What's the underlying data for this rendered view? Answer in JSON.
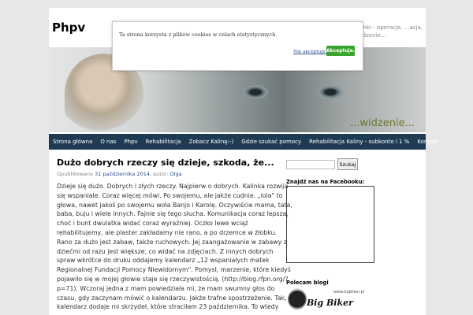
{
  "site": {
    "title": "Phpv",
    "tagline": "...inki - operacje, ...acja, widzenie..."
  },
  "banner": {
    "caption": "...widzenie..."
  },
  "nav": {
    "items": [
      "Strona główna",
      "O nas",
      "Phpv",
      "Rehabilitacja",
      "Zobacz Kalinę:-)",
      "Gdzie szukać pomocy",
      "Rehabilitacja Kaliny - subkonto i 1 %",
      "Kontakt"
    ]
  },
  "post": {
    "title": "Dużo dobrych rzeczy się dzieje, szkoda, że...",
    "meta_prefix": "Opublikowano",
    "date": "31 października 2014",
    "meta_author_prefix": ", autor:",
    "author": "Olga",
    "body": "Dzieje się dużo. Dobrych i złych rzeczy. Najpierw o dobrych. Kalinka rozwija się wspaniale. Coraz więcej mówi. Po swojemu, ale jakże cudnie. „lola\" to głowa, nawet jakoś po swojemu woła Banjo i Karolę. Oczywiście mama, tata, baba, buju i wiele innych. Fajnie się tego słucha. Komunikacja coraz lepsza, choć i bunt dwulatka widać coraz wyraźniej. Oczko lewe wciąż rehabilitujemy, ale plaster zakładamy nie rano, a po drzemce w żłobku. Rano za dużo jest zabaw, także ruchowych. Jej zaangażowanie w zabawy z dziećmi od razu jest większe, co widać na zdjęciach. Z innych dobrych spraw wkrótce do druku oddajemy kalendarz „12 wspaniałych matek Regionalnej Fundacji Pomocy Niewidomym\". Pomysł, marzenie, które kiedyś pojawiło się w mojej głowie staje się rzeczywistością. (http://blog.rfpn.org/?p=71). Wczoraj jedna z mam powiedziała mi, że mam swumny głos do czasu, gdy zaczynam mówić o kalendarzu. Jakże trafne spostrzeżenie. Tak, kalendarz dodaje mi skrzydeł, które straciłam 23 października. To wtedy"
  },
  "sidebar": {
    "search_button": "Szukaj",
    "facebook_heading": "Znajdź nas na Facebooku:",
    "blogs_heading": "Polecam blogi",
    "blog_logo_text": "Big Biker",
    "blog_logo_small": "www.bigbiker.pl"
  },
  "cookie": {
    "text": "Ta strona korzysta z plików cookies w celach statystycznych.",
    "decline": "Nie akceptuje.",
    "accept": "Akceptuje."
  }
}
